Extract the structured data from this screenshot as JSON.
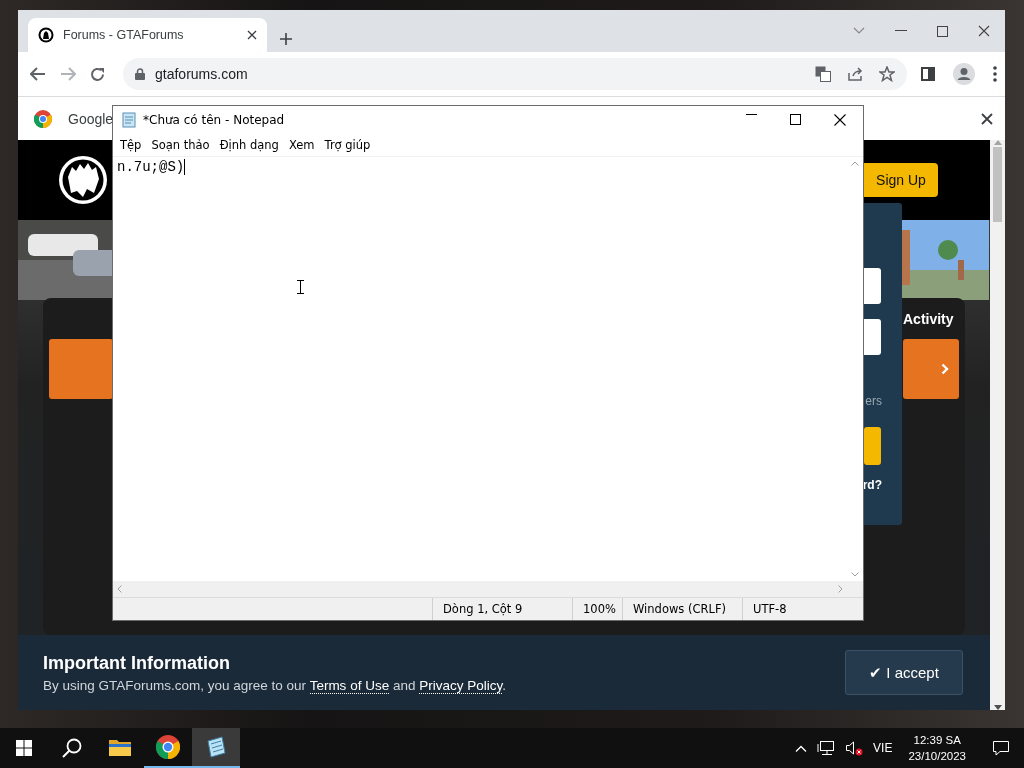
{
  "browser": {
    "tabs": [
      {
        "title": "Forums - GTAForums",
        "selected": true
      }
    ],
    "toolbar": {
      "back_disabled": false,
      "forward_disabled": true,
      "address": "gtaforums.com"
    },
    "infobar": {
      "text": "Google"
    }
  },
  "page": {
    "header": {
      "sign_up": "Sign Up"
    },
    "login_panel": {
      "fragments": [
        "ers",
        "rd?"
      ]
    },
    "activity": "Activity",
    "notice": {
      "title": "Important Information",
      "segments": [
        {
          "kind": "text",
          "text": "By using GTAForums.com, you agree to our "
        },
        {
          "kind": "link",
          "text": "Terms of Use"
        },
        {
          "kind": "text",
          "text": " and "
        },
        {
          "kind": "link",
          "text": "Privacy Policy"
        },
        {
          "kind": "text",
          "text": "."
        }
      ],
      "accept": "✔ I accept"
    }
  },
  "notepad": {
    "title": "*Chưa có tên - Notepad",
    "menu": [
      "Tệp",
      "Soạn thảo",
      "Định dạng",
      "Xem",
      "Trợ giúp"
    ],
    "content": "n.7u;@S)",
    "status": [
      "Dòng 1, Cột 9",
      "100%",
      "Windows (CRLF)",
      "UTF-8"
    ]
  },
  "taskbar": {
    "apps": [
      {
        "kind": "explorer",
        "running": false,
        "selected": false
      },
      {
        "kind": "chrome",
        "running": true,
        "selected": false
      },
      {
        "kind": "notepad",
        "running": true,
        "selected": true
      }
    ],
    "volume_muted": true,
    "language": "VIE",
    "time": "12:39 SA",
    "date": "23/10/2023"
  }
}
